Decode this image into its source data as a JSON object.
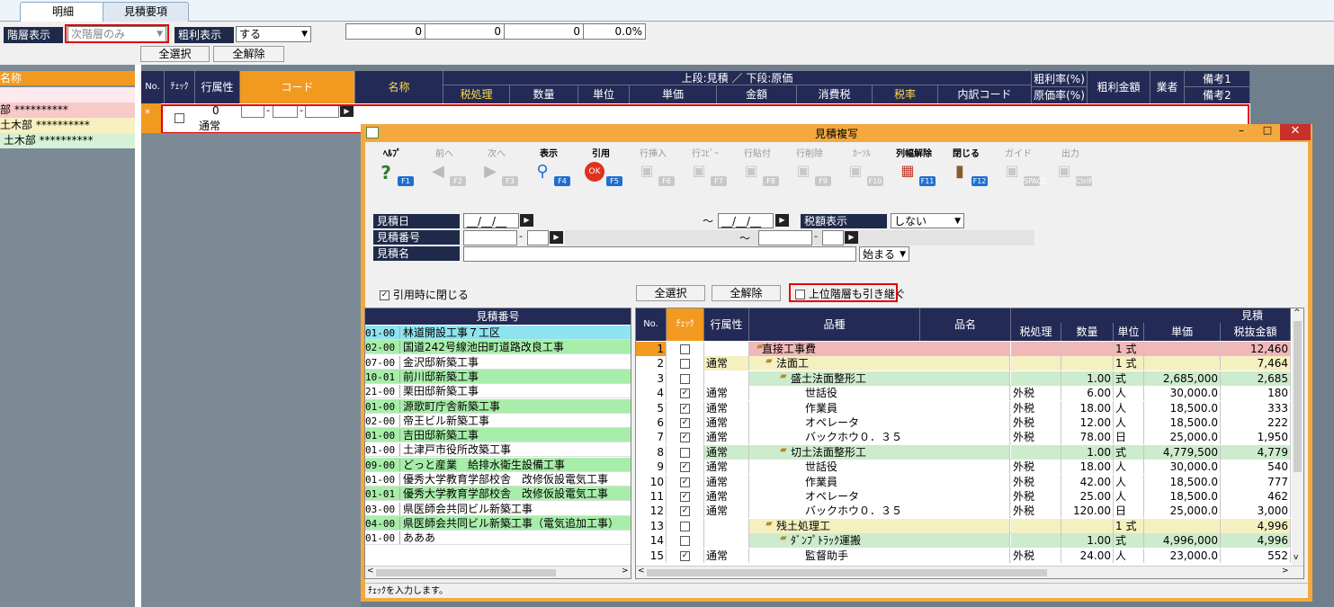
{
  "tabs": [
    "明細",
    "見積要項"
  ],
  "controls": {
    "hierarchy_label": "階層表示",
    "hierarchy_value": "次階層のみ",
    "profit_label": "粗利表示",
    "profit_value": "する",
    "select_all": "全選択",
    "deselect_all": "全解除",
    "totals": [
      "0",
      "0",
      "0",
      "0.0%"
    ]
  },
  "left_tree": {
    "header": "名称",
    "rows": [
      {
        "text": "",
        "color": "#fde9ee"
      },
      {
        "text": "部 **********",
        "color": "#f8c9c9"
      },
      {
        "text": "土木部 **********",
        "color": "#f8f0c0"
      },
      {
        "text": " 土木部 **********",
        "color": "#d6f2d6"
      }
    ]
  },
  "grid": {
    "headers_top": {
      "no": "No.",
      "check": "ﾁｪｯｸ",
      "attr": "行属性",
      "code": "コード",
      "name": "名称",
      "upper": "上段:見積 ／ 下段:原価",
      "rate1": "粗利率(%)",
      "rate2": "原価率(%)",
      "profit": "粗利金額",
      "vendor": "業者",
      "note1": "備考1",
      "note2": "備考2"
    },
    "headers_sub": [
      "税処理",
      "数量",
      "単位",
      "単価",
      "金額",
      "消費税",
      "税率",
      "内訳コード"
    ],
    "row": {
      "marker": "*",
      "num": "0",
      "attr": "通常"
    }
  },
  "dialog": {
    "title": "見積複写",
    "toolbar": [
      {
        "label": "ﾍﾙﾌﾟ",
        "key": "F1",
        "icon": "help-icon",
        "enabled": true
      },
      {
        "label": "前へ",
        "key": "F2",
        "icon": "arrow-left-icon",
        "enabled": false
      },
      {
        "label": "次へ",
        "key": "F3",
        "icon": "arrow-right-icon",
        "enabled": false
      },
      {
        "label": "表示",
        "key": "F4",
        "icon": "magnifier-icon",
        "enabled": true
      },
      {
        "label": "引用",
        "key": "F5",
        "icon": "ok-icon",
        "enabled": true
      },
      {
        "label": "行挿入",
        "key": "F6",
        "icon": "insert-row-icon",
        "enabled": false
      },
      {
        "label": "行ｺﾋﾟｰ",
        "key": "F7",
        "icon": "copy-row-icon",
        "enabled": false
      },
      {
        "label": "行貼付",
        "key": "F8",
        "icon": "paste-row-icon",
        "enabled": false
      },
      {
        "label": "行削除",
        "key": "F9",
        "icon": "delete-row-icon",
        "enabled": false
      },
      {
        "label": "ｶｰｿﾙ",
        "key": "F10",
        "icon": "cursor-icon",
        "enabled": false
      },
      {
        "label": "列幅解除",
        "key": "F11",
        "icon": "column-width-icon",
        "enabled": true
      },
      {
        "label": "閉じる",
        "key": "F12",
        "icon": "close-door-icon",
        "enabled": true
      },
      {
        "label": "ガイド",
        "key": "SPACE",
        "icon": "guide-icon",
        "enabled": false
      },
      {
        "label": "出力",
        "key": "CtrlP",
        "icon": "output-icon",
        "enabled": false
      }
    ],
    "form": {
      "date_label": "見積日",
      "date_from": "__/__/__",
      "tilde": "～",
      "date_to": "__/__/__",
      "tax_label": "税額表示",
      "tax_value": "しない",
      "number_label": "見積番号",
      "name_label": "見積名",
      "name_mode": "始まる",
      "close_on_quote": "引用時に閉じる",
      "select_all": "全選択",
      "deselect_all": "全解除",
      "inherit_upper": "上位階層も引き継ぐ"
    },
    "estimate_list": {
      "header": "見積番号",
      "rows": [
        {
          "code": "01-00",
          "name": "林道開設工事７工区",
          "color": "#8fe3ee"
        },
        {
          "code": "02-00",
          "name": "国道242号線池田町道路改良工事",
          "color": "#a8eeaa"
        },
        {
          "code": "07-00",
          "name": "金沢邸新築工事",
          "color": "#ffffff"
        },
        {
          "code": "10-01",
          "name": "前川邸新築工事",
          "color": "#a8eeaa"
        },
        {
          "code": "21-00",
          "name": "栗田邸新築工事",
          "color": "#ffffff"
        },
        {
          "code": "01-00",
          "name": "源歌町庁舎新築工事",
          "color": "#a8eeaa"
        },
        {
          "code": "02-00",
          "name": "帝王ビル新築工事",
          "color": "#ffffff"
        },
        {
          "code": "01-00",
          "name": "吉田邸新築工事",
          "color": "#a8eeaa"
        },
        {
          "code": "01-00",
          "name": "土津戸市役所改築工事",
          "color": "#ffffff"
        },
        {
          "code": "09-00",
          "name": "どっと産業　給排水衛生設備工事",
          "color": "#a8eeaa"
        },
        {
          "code": "01-00",
          "name": "優秀大学教育学部校舎　改修仮設電気工事",
          "color": "#ffffff"
        },
        {
          "code": "01-01",
          "name": "優秀大学教育学部校舎　改修仮設電気工事",
          "color": "#a8eeaa"
        },
        {
          "code": "03-00",
          "name": "県医師会共同ビル新築工事",
          "color": "#ffffff"
        },
        {
          "code": "04-00",
          "name": "県医師会共同ビル新築工事（電気追加工事）",
          "color": "#a8eeaa"
        },
        {
          "code": "01-00",
          "name": "あああ",
          "color": "#ffffff"
        }
      ]
    },
    "detail": {
      "headers": {
        "no": "No.",
        "check": "ﾁｪｯｸ",
        "attr": "行属性",
        "item": "品種",
        "name": "品名",
        "estimate": "見積",
        "tax": "税処理",
        "qty": "数量",
        "unit": "単位",
        "price": "単価",
        "amount": "税抜金額"
      },
      "rows": [
        {
          "no": "1",
          "check": false,
          "attr": "",
          "indent": 0,
          "item": "直接工事費",
          "tax": "",
          "qty": "",
          "unit": "1 式",
          "price": "",
          "amount": "12,460",
          "color": "#f0b8b8"
        },
        {
          "no": "2",
          "check": false,
          "attr": "通常",
          "indent": 1,
          "item": "法面工",
          "tax": "",
          "qty": "",
          "unit": "1 式",
          "price": "",
          "amount": "7,464",
          "color": "#f5f0c0"
        },
        {
          "no": "3",
          "check": false,
          "attr": "",
          "indent": 2,
          "item": "盛土法面整形工",
          "tax": "",
          "qty": "1.00",
          "unit": "式",
          "price": "2,685,000",
          "amount": "2,685",
          "color": "#cdebcd"
        },
        {
          "no": "4",
          "check": true,
          "attr": "通常",
          "indent": 3,
          "item": "世話役",
          "tax": "外税",
          "qty": "6.00",
          "unit": "人",
          "price": "30,000.0",
          "amount": "180",
          "color": "#ffffff"
        },
        {
          "no": "5",
          "check": true,
          "attr": "通常",
          "indent": 3,
          "item": "作業員",
          "tax": "外税",
          "qty": "18.00",
          "unit": "人",
          "price": "18,500.0",
          "amount": "333",
          "color": "#ffffff"
        },
        {
          "no": "6",
          "check": true,
          "attr": "通常",
          "indent": 3,
          "item": "オペレータ",
          "tax": "外税",
          "qty": "12.00",
          "unit": "人",
          "price": "18,500.0",
          "amount": "222",
          "color": "#ffffff"
        },
        {
          "no": "7",
          "check": true,
          "attr": "通常",
          "indent": 3,
          "item": "バックホウ０．３５",
          "tax": "外税",
          "qty": "78.00",
          "unit": "日",
          "price": "25,000.0",
          "amount": "1,950",
          "color": "#ffffff"
        },
        {
          "no": "8",
          "check": false,
          "attr": "通常",
          "indent": 2,
          "item": "切土法面整形工",
          "tax": "",
          "qty": "1.00",
          "unit": "式",
          "price": "4,779,500",
          "amount": "4,779",
          "color": "#cdebcd"
        },
        {
          "no": "9",
          "check": true,
          "attr": "通常",
          "indent": 3,
          "item": "世話役",
          "tax": "外税",
          "qty": "18.00",
          "unit": "人",
          "price": "30,000.0",
          "amount": "540",
          "color": "#ffffff"
        },
        {
          "no": "10",
          "check": true,
          "attr": "通常",
          "indent": 3,
          "item": "作業員",
          "tax": "外税",
          "qty": "42.00",
          "unit": "人",
          "price": "18,500.0",
          "amount": "777",
          "color": "#ffffff"
        },
        {
          "no": "11",
          "check": true,
          "attr": "通常",
          "indent": 3,
          "item": "オペレータ",
          "tax": "外税",
          "qty": "25.00",
          "unit": "人",
          "price": "18,500.0",
          "amount": "462",
          "color": "#ffffff"
        },
        {
          "no": "12",
          "check": true,
          "attr": "通常",
          "indent": 3,
          "item": "バックホウ０．３５",
          "tax": "外税",
          "qty": "120.00",
          "unit": "日",
          "price": "25,000.0",
          "amount": "3,000",
          "color": "#ffffff"
        },
        {
          "no": "13",
          "check": false,
          "attr": "",
          "indent": 1,
          "item": "残土処理工",
          "tax": "",
          "qty": "",
          "unit": "1 式",
          "price": "",
          "amount": "4,996",
          "color": "#f5f0c0"
        },
        {
          "no": "14",
          "check": false,
          "attr": "",
          "indent": 2,
          "item": "ﾀﾞﾝﾌﾟﾄﾗｯｸ運搬",
          "tax": "",
          "qty": "1.00",
          "unit": "式",
          "price": "4,996,000",
          "amount": "4,996",
          "color": "#cdebcd"
        },
        {
          "no": "15",
          "check": true,
          "attr": "通常",
          "indent": 3,
          "item": "監督助手",
          "tax": "外税",
          "qty": "24.00",
          "unit": "人",
          "price": "23,000.0",
          "amount": "552",
          "color": "#ffffff"
        }
      ]
    },
    "status": "ﾁｪｯｸを入力します。"
  }
}
